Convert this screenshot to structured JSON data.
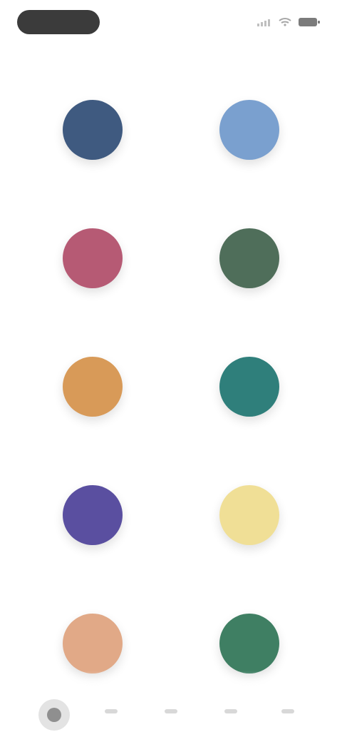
{
  "status_bar": {
    "time": "",
    "icons": [
      "signal-icon",
      "wifi-icon",
      "battery-icon"
    ]
  },
  "header": {
    "subtitle": ""
  },
  "grid": {
    "items": [
      {
        "label": "",
        "color": "#3f5a80"
      },
      {
        "label": "",
        "color": "#7aa0cf"
      },
      {
        "label": "",
        "color": "#b65a74"
      },
      {
        "label": "",
        "color": "#4f6e5a"
      },
      {
        "label": "",
        "color": "#d89a58"
      },
      {
        "label": "",
        "color": "#2f7f7b"
      },
      {
        "label": "",
        "color": "#5a4fa0"
      },
      {
        "label": "",
        "color": "#f0df96"
      },
      {
        "label": "",
        "color": "#e1a987"
      },
      {
        "label": "",
        "color": "#3f7f63"
      }
    ]
  },
  "bottom_nav": {
    "items": [
      {
        "name": "nav-home",
        "active": true
      },
      {
        "name": "nav-item-2",
        "active": false
      },
      {
        "name": "nav-item-3",
        "active": false
      },
      {
        "name": "nav-item-4",
        "active": false
      },
      {
        "name": "nav-item-5",
        "active": false
      }
    ]
  }
}
